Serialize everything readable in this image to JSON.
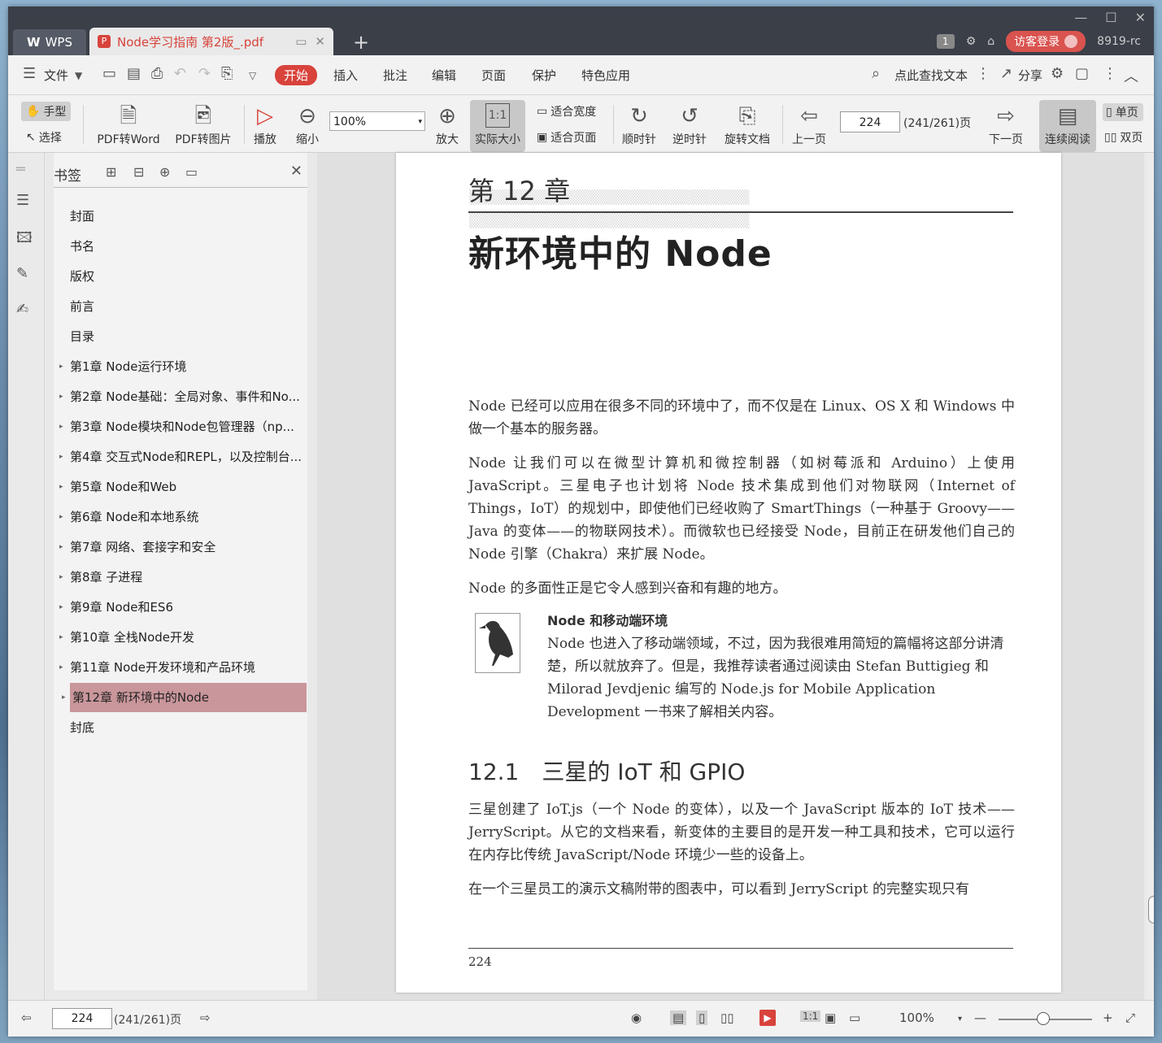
{
  "titlebar": {
    "app_tab": "WPS",
    "doc_tab": "Node学习指南 第2版_.pdf",
    "badge": "1",
    "login_label": "访客登录",
    "version": "8919-rc"
  },
  "menubar": {
    "file": "文件",
    "tabs": [
      "开始",
      "插入",
      "批注",
      "编辑",
      "页面",
      "保护",
      "特色应用"
    ],
    "search": "点此查找文本",
    "share": "分享"
  },
  "toolbar": {
    "hand": "手型",
    "select": "选择",
    "pdf_word": "PDF转Word",
    "pdf_img": "PDF转图片",
    "play": "播放",
    "zoom_out": "缩小",
    "zoom_value": "100%",
    "zoom_in": "放大",
    "actual_size": "实际大小",
    "fit_width": "适合宽度",
    "fit_page": "适合页面",
    "clockwise": "顺时针",
    "counter": "逆时针",
    "rotate_doc": "旋转文档",
    "prev": "上一页",
    "page_input": "224",
    "page_total": "(241/261)页",
    "next": "下一页",
    "continuous": "连续阅读",
    "single": "单页",
    "double": "双页"
  },
  "bookmarks": {
    "title": "书签",
    "items": [
      "封面",
      "书名",
      "版权",
      "前言",
      "目录",
      "第1章 Node运行环境",
      "第2章 Node基础：全局对象、事件和No...",
      "第3章 Node模块和Node包管理器（np...",
      "第4章 交互式Node和REPL，以及控制台...",
      "第5章 Node和Web",
      "第6章 Node和本地系统",
      "第7章 网络、套接字和安全",
      "第8章 子进程",
      "第9章 Node和ES6",
      "第10章 全栈Node开发",
      "第11章 Node开发环境和产品环境",
      "第12章 新环境中的Node",
      "封底"
    ]
  },
  "page": {
    "chapter": "第 12 章",
    "title": "新环境中的 Node",
    "p1": "Node 已经可以应用在很多不同的环境中了，而不仅是在 Linux、OS X 和 Windows 中做一个基本的服务器。",
    "p2": "Node 让我们可以在微型计算机和微控制器（如树莓派和 Arduino）上使用 JavaScript。三星电子也计划将 Node 技术集成到他们对物联网（Internet of Things，IoT）的规划中，即使他们已经收购了 SmartThings（一种基于 Groovy——Java 的变体——的物联网技术）。而微软也已经接受 Node，目前正在研发他们自己的 Node 引擎（Chakra）来扩展 Node。",
    "p3": "Node 的多面性正是它令人感到兴奋和有趣的地方。",
    "note_title": "Node 和移动端环境",
    "note_body": "Node 也进入了移动端领域，不过，因为我很难用简短的篇幅将这部分讲清楚，所以就放弃了。但是，我推荐读者通过阅读由 Stefan Buttigieg 和 Milorad Jevdjenic 编写的 Node.js for Mobile Application Development 一书来了解相关内容。",
    "section": "12.1　三星的 IoT 和 GPIO",
    "p4": "三星创建了 IoT.js（一个 Node 的变体），以及一个 JavaScript 版本的 IoT 技术——JerryScript。从它的文档来看，新变体的主要目的是开发一种工具和技术，它可以运行在内存比传统 JavaScript/Node 环境少一些的设备上。",
    "p5": "在一个三星员工的演示文稿附带的图表中，可以看到 JerryScript 的完整实现只有",
    "page_number": "224"
  },
  "statusbar": {
    "page_input": "224",
    "page_total": "(241/261)页",
    "zoom": "100%"
  },
  "colors": {
    "accent": "#d8433c",
    "bookmark_selected": "#c9969b"
  }
}
